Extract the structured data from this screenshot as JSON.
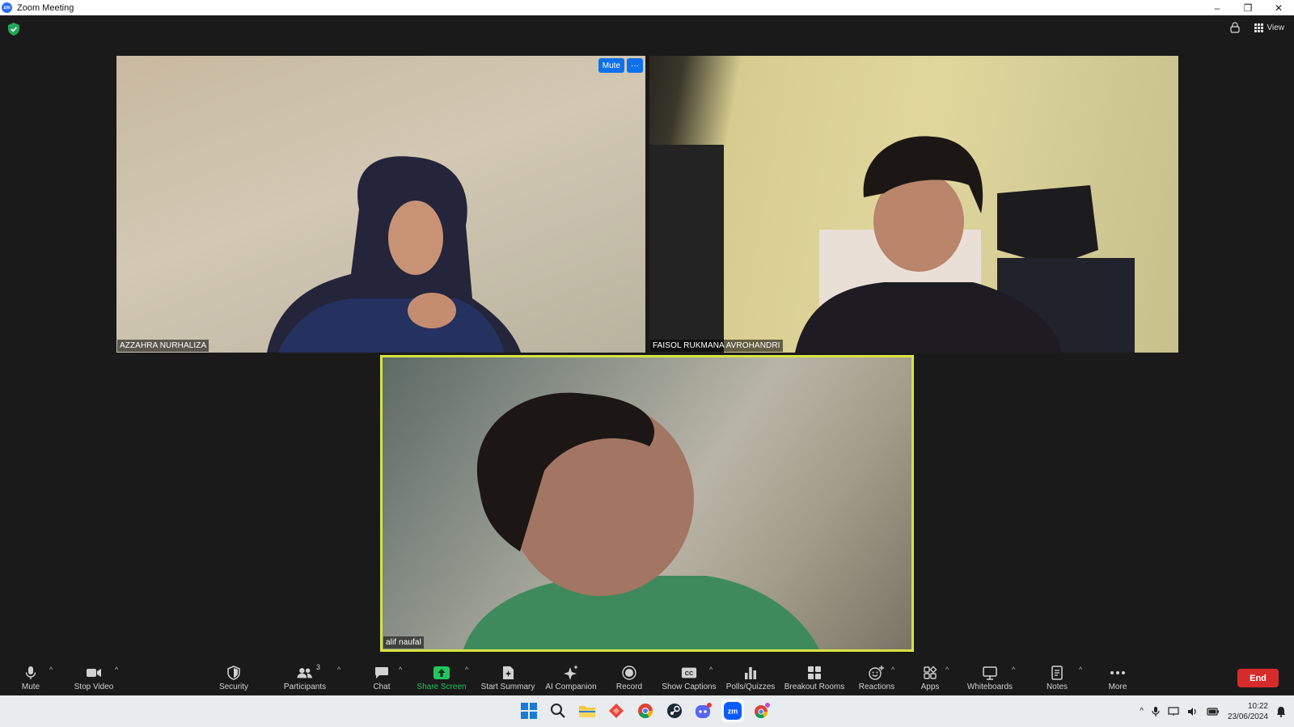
{
  "window": {
    "title": "Zoom Meeting",
    "app_icon_text": "zm",
    "controls": {
      "minimize": "–",
      "restore": "❐",
      "close": "✕"
    }
  },
  "header": {
    "view_label": "View"
  },
  "participants": [
    {
      "name": "AZZAHRA NURHALIZA",
      "actions": {
        "mute": "Mute",
        "more": "···"
      }
    },
    {
      "name": "FAISOL RUKMANA AVROHANDRI"
    },
    {
      "name": "alif naufal",
      "active_speaker": true,
      "highlight_color": "#d6e43f"
    }
  ],
  "toolbar": {
    "mute": "Mute",
    "stop_video": "Stop Video",
    "security": "Security",
    "participants": "Participants",
    "participants_count": "3",
    "chat": "Chat",
    "share_screen": "Share Screen",
    "start_summary": "Start Summary",
    "ai_companion": "AI Companion",
    "record": "Record",
    "show_captions": "Show Captions",
    "polls": "Polls/Quizzes",
    "breakout": "Breakout Rooms",
    "reactions": "Reactions",
    "apps": "Apps",
    "whiteboards": "Whiteboards",
    "notes": "Notes",
    "more": "More",
    "end": "End",
    "caret": "^"
  },
  "colors": {
    "share_green": "#22c55e",
    "end_red": "#d62b2b",
    "accent_blue": "#0e71eb"
  },
  "taskbar": {
    "icons": [
      "windows-start-icon",
      "search-icon",
      "file-explorer-icon",
      "anydesk-icon",
      "chrome-icon",
      "steam-icon",
      "discord-icon",
      "zoom-icon",
      "chrome-profile-icon"
    ],
    "zoom_label": "zm",
    "tray": {
      "chevron": "^",
      "time": "10:22",
      "date": "23/06/2024"
    }
  }
}
